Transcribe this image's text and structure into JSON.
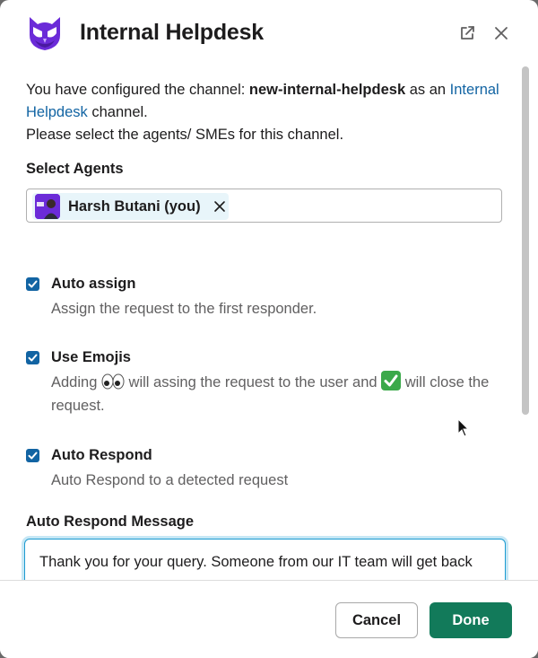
{
  "header": {
    "title": "Internal Helpdesk",
    "logo_icon": "owl-logo-icon",
    "popout_icon": "external-link-icon",
    "close_icon": "close-icon"
  },
  "intro": {
    "line1_prefix": "You have configured the channel: ",
    "channel_name": "new-internal-helpdesk",
    "line1_mid": " as an ",
    "link_text": "Internal Helpdesk",
    "line1_suffix": " channel.",
    "line2": "Please select the agents/ SMEs for this channel."
  },
  "agents": {
    "label": "Select Agents",
    "selected": [
      {
        "name": "Harsh Butani (you)"
      }
    ]
  },
  "options": [
    {
      "title": "Auto assign",
      "checked": true,
      "description": "Assign the request to the first responder."
    },
    {
      "title": "Use Emojis",
      "checked": true,
      "desc_part1": "Adding ",
      "desc_part2": " will assing the request to the user and ",
      "desc_part3": " will close the request.",
      "emoji1": "eyes-emoji",
      "emoji2": "check-mark-button-emoji"
    },
    {
      "title": "Auto Respond",
      "checked": true,
      "description": "Auto Respond to a detected request"
    }
  ],
  "auto_respond": {
    "label": "Auto Respond Message",
    "value": "Thank you for your query. Someone from our IT team will get back"
  },
  "footer": {
    "cancel_label": "Cancel",
    "done_label": "Done"
  },
  "colors": {
    "accent": "#1264a3",
    "done_button": "#127a5a",
    "logo": "#6b2bd8"
  }
}
